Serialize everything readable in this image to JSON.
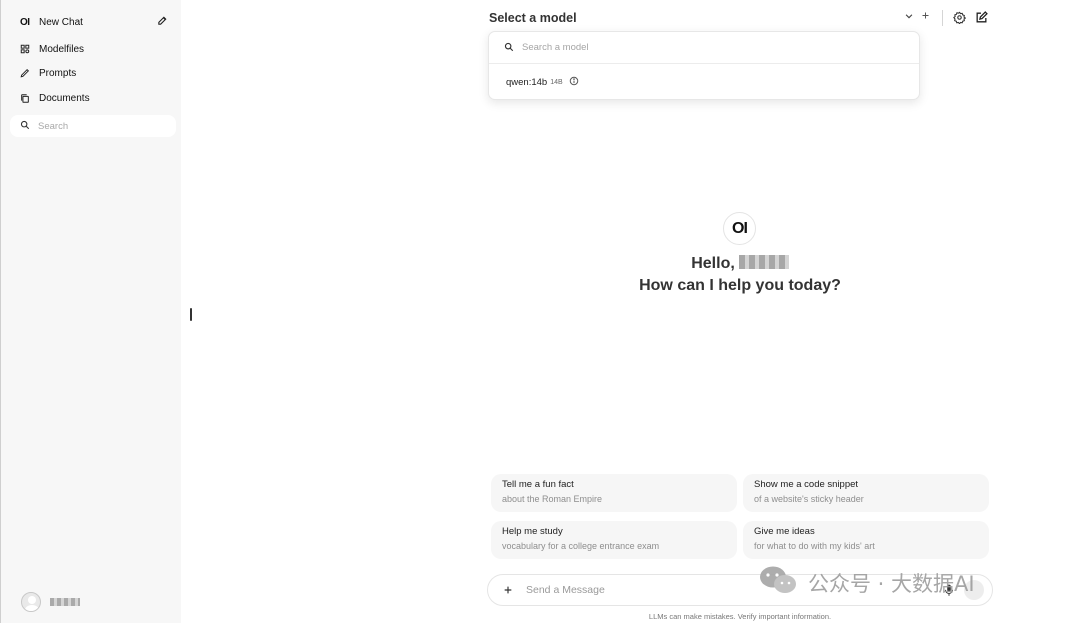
{
  "sidebar": {
    "logo": "OI",
    "new_chat": "New Chat",
    "items": [
      {
        "label": "Modelfiles",
        "icon": "grid-icon"
      },
      {
        "label": "Prompts",
        "icon": "pencil-icon"
      },
      {
        "label": "Documents",
        "icon": "documents-icon"
      }
    ],
    "search_placeholder": "Search"
  },
  "header": {
    "model_select": "Select a model"
  },
  "model_dropdown": {
    "search_placeholder": "Search a model",
    "models": [
      {
        "name": "qwen:14b",
        "size": "14B"
      }
    ]
  },
  "greeting": {
    "logo": "OI",
    "hello": "Hello,",
    "subtitle": "How can I help you today?"
  },
  "suggestions": [
    {
      "title": "Tell me a fun fact",
      "subtitle": "about the Roman Empire"
    },
    {
      "title": "Show me a code snippet",
      "subtitle": "of a website's sticky header"
    },
    {
      "title": "Help me study",
      "subtitle": "vocabulary for a college entrance exam"
    },
    {
      "title": "Give me ideas",
      "subtitle": "for what to do with my kids' art"
    }
  ],
  "composer": {
    "placeholder": "Send a Message",
    "disclaimer": "LLMs can make mistakes. Verify important information."
  },
  "watermark": {
    "text": "公众号 · 大数据AI"
  },
  "colors": {
    "sidebar_bg": "#f7f7f7",
    "card_bg": "#f6f6f6",
    "text_primary": "#333333",
    "text_muted": "#8e8e8e"
  }
}
